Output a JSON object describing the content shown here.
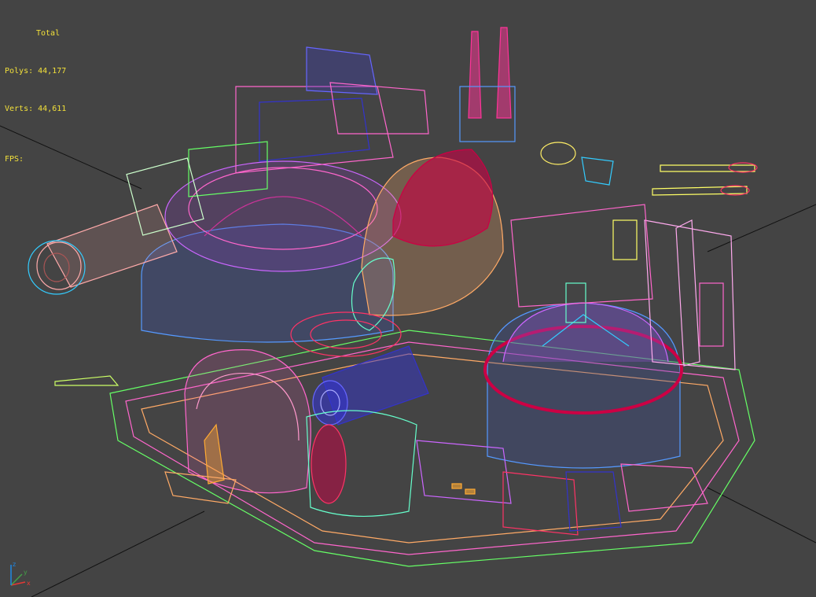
{
  "viewport": {
    "background": "#444444",
    "stats": {
      "header": "Total",
      "polys_label": "Polys:",
      "polys_value": "44,177",
      "verts_label": "Verts:",
      "verts_value": "44,611",
      "fps_label": "FPS:"
    },
    "axis_gizmo": {
      "x_label": "x",
      "y_label": "y",
      "z_label": "z"
    },
    "wireframe_colors": [
      "#ff66cc",
      "#5599ff",
      "#66ff66",
      "#ffaa66",
      "#ff3366",
      "#33ccff",
      "#cc66ff",
      "#ffff66",
      "#3333cc",
      "#cc0044"
    ]
  }
}
